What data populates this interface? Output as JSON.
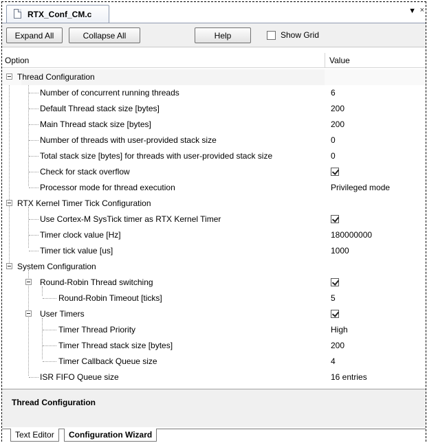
{
  "tab": {
    "filename": "RTX_Conf_CM.c",
    "dropdown_glyph": "▼",
    "close_glyph": "×"
  },
  "toolbar": {
    "expand_all": "Expand All",
    "collapse_all": "Collapse All",
    "help": "Help",
    "show_grid": "Show Grid"
  },
  "columns": {
    "option": "Option",
    "value": "Value"
  },
  "tree": {
    "thread_config": {
      "label": "Thread Configuration",
      "items": [
        {
          "label": "Number of concurrent running threads",
          "value": "6"
        },
        {
          "label": "Default Thread stack size [bytes]",
          "value": "200"
        },
        {
          "label": "Main Thread stack size [bytes]",
          "value": "200"
        },
        {
          "label": "Number of threads with user-provided stack size",
          "value": "0"
        },
        {
          "label": "Total stack size [bytes] for threads with user-provided stack size",
          "value": "0"
        },
        {
          "label": "Check for stack overflow",
          "value": ""
        },
        {
          "label": "Processor mode for thread execution",
          "value": "Privileged mode"
        }
      ]
    },
    "timer_tick": {
      "label": "RTX Kernel Timer Tick Configuration",
      "items": [
        {
          "label": "Use Cortex-M SysTick timer as RTX Kernel Timer",
          "value": ""
        },
        {
          "label": "Timer clock value [Hz]",
          "value": "180000000"
        },
        {
          "label": "Timer tick value [us]",
          "value": "1000"
        }
      ]
    },
    "system_config": {
      "label": "System Configuration",
      "round_robin": {
        "label": "Round-Robin Thread switching",
        "timeout_label": "Round-Robin Timeout [ticks]",
        "timeout_value": "5"
      },
      "user_timers": {
        "label": "User Timers",
        "items": [
          {
            "label": "Timer Thread Priority",
            "value": "High"
          },
          {
            "label": "Timer Thread stack size [bytes]",
            "value": "200"
          },
          {
            "label": "Timer Callback Queue size",
            "value": "4"
          }
        ]
      },
      "isr_fifo_label": "ISR FIFO Queue size",
      "isr_fifo_value": "16 entries"
    }
  },
  "description": {
    "title": "Thread Configuration"
  },
  "bottom_tabs": {
    "text_editor": "Text Editor",
    "config_wizard": "Configuration Wizard"
  }
}
